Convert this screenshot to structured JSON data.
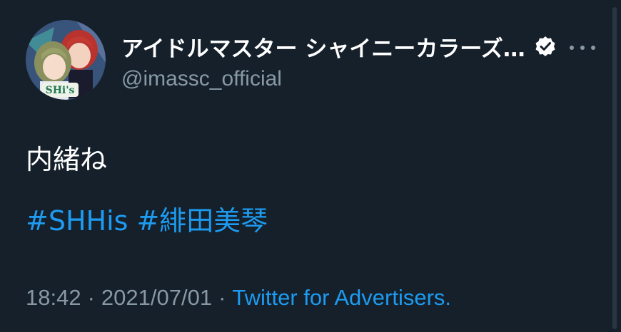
{
  "tweet": {
    "display_name": "アイドルマスター シャイニーカラーズ…",
    "handle": "@imassc_official",
    "avatar_badge": "SHi's",
    "text": "内緒ね",
    "hashtags": [
      "#SHHis",
      "#緋田美琴"
    ],
    "time": "18:42",
    "separator": "·",
    "date": "2021/07/01",
    "client": "Twitter for Advertisers."
  },
  "icons": {
    "verified": "verified-badge-icon",
    "more": "more-options-icon"
  },
  "colors": {
    "background": "#15202b",
    "link": "#1d9bf0",
    "secondary_text": "#8899a6",
    "primary_text": "#ffffff"
  }
}
